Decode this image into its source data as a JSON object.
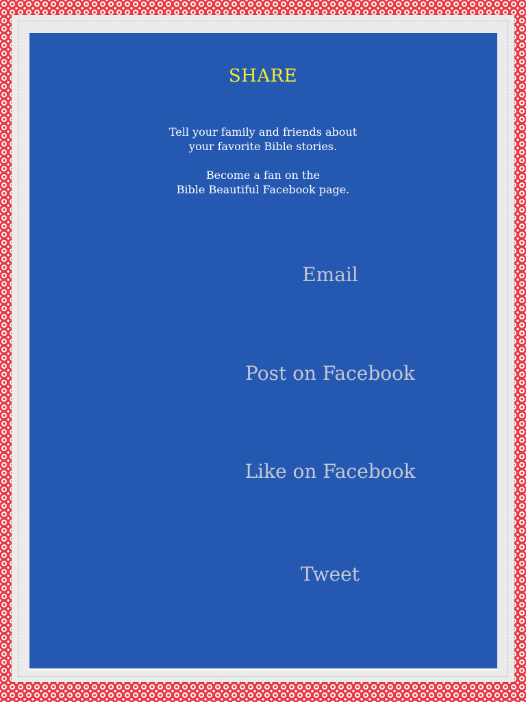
{
  "title": "SHARE",
  "intro": {
    "line1": "Tell your family and friends about",
    "line2": "your favorite Bible stories.",
    "line3": "Become a fan on the",
    "line4": "Bible Beautiful Facebook page."
  },
  "actions": [
    {
      "label": "Email"
    },
    {
      "label": "Post on Facebook"
    },
    {
      "label": "Like on Facebook"
    },
    {
      "label": "Tweet"
    }
  ],
  "colors": {
    "panel": "#2558b1",
    "title": "#f6f12b",
    "intro_text": "#ffffff",
    "action_text": "#c5c8d4",
    "border_pattern": "#e63b45"
  }
}
